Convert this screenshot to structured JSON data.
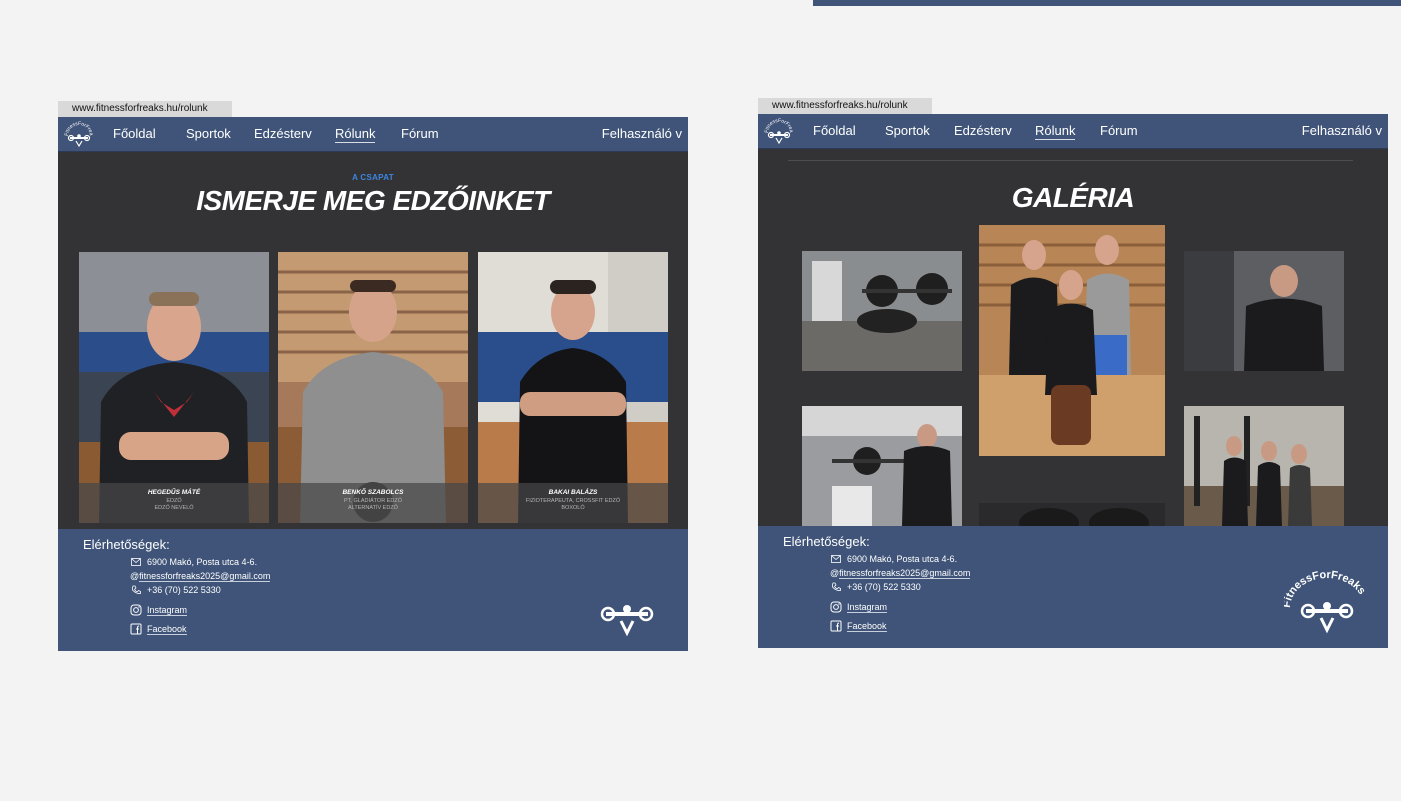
{
  "browser": {
    "url_left": "www.fitnessforfreaks.hu/rolunk",
    "url_right": "www.fitnessforfreaks.hu/rolunk"
  },
  "nav": {
    "items": [
      "Főoldal",
      "Sportok",
      "Edzésterv",
      "Rólunk",
      "Fórum"
    ],
    "active": "Rólunk",
    "user_menu": "Felhasználó v"
  },
  "team_page": {
    "eyebrow": "A CSAPAT",
    "title": "ISMERJE MEG EDZŐINKET",
    "coaches": [
      {
        "name": "HEGEDŰS MÁTÉ",
        "role_line1": "EDZŐ",
        "role_line2": "EDZŐ NEVELŐ"
      },
      {
        "name": "BENKŐ SZABOLCS",
        "role_line1": "PT, GLADIÁTOR EDZŐ",
        "role_line2": "ALTERNATÍV EDZŐ"
      },
      {
        "name": "BAKAI BALÁZS",
        "role_line1": "FIZIOTERAPEUTA, CROSSFIT EDZŐ",
        "role_line2": "BOXOLÓ"
      }
    ]
  },
  "gallery_page": {
    "title": "GALÉRIA"
  },
  "footer": {
    "title": "Elérhetőségek:",
    "address": "6900 Makó, Posta utca 4-6.",
    "email": "fitnessforfreaks2025@gmail.com",
    "phone": "+36 (70) 522 5330",
    "instagram": "Instagram",
    "facebook": "Facebook",
    "logo_text": "FitnessForFreaks"
  },
  "colors": {
    "nav_bg": "#3f5478",
    "page_bg": "#333335",
    "accent_blue": "#3c86e0",
    "canvas_bg": "#f3f3f4"
  },
  "icons": [
    "logo-icon",
    "mail-icon",
    "at-icon",
    "phone-icon",
    "instagram-icon",
    "facebook-icon"
  ]
}
